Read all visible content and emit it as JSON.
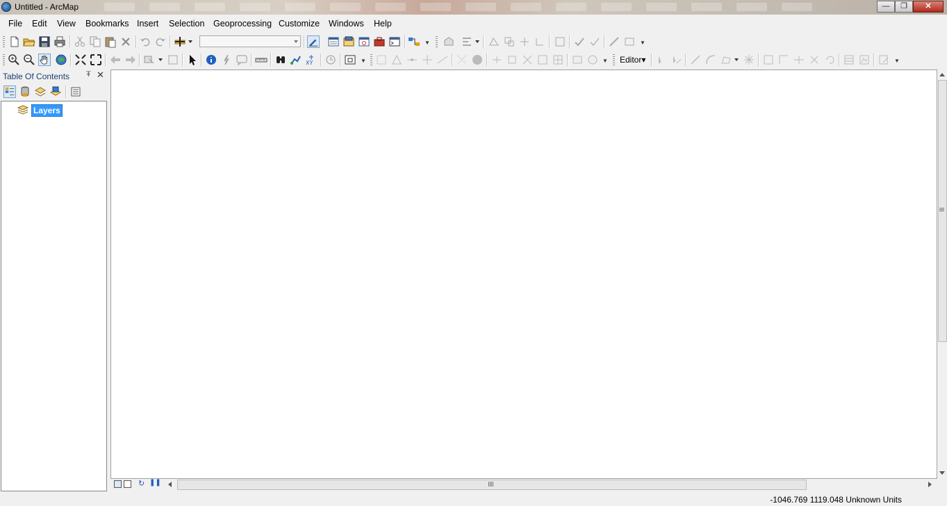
{
  "window": {
    "title": "Untitled - ArcMap"
  },
  "menu": [
    "File",
    "Edit",
    "View",
    "Bookmarks",
    "Insert",
    "Selection",
    "Geoprocessing",
    "Customize",
    "Windows",
    "Help"
  ],
  "toolbar1_icons": [
    "new-document-icon",
    "open-folder-icon",
    "save-icon",
    "print-icon",
    "cut-icon",
    "copy-icon",
    "paste-icon",
    "delete-icon",
    "undo-icon",
    "redo-icon",
    "add-data-icon",
    "editor-toolbar-icon",
    "table-of-contents-icon",
    "catalog-icon",
    "search-window-icon",
    "arctoolbox-icon",
    "python-window-icon",
    "model-builder-icon"
  ],
  "toolbar2_icons": [
    "zoom-in-icon",
    "zoom-out-icon",
    "pan-icon",
    "full-extent-icon",
    "fixed-zoom-in-icon",
    "fixed-zoom-out-icon",
    "back-extent-icon",
    "forward-extent-icon",
    "select-features-icon",
    "clear-selection-icon",
    "select-elements-icon",
    "identify-icon",
    "hyperlink-icon",
    "html-popup-icon",
    "measure-icon",
    "find-icon",
    "find-route-icon",
    "go-to-xy-icon",
    "time-slider-icon",
    "create-viewer-window-icon"
  ],
  "editor": {
    "label": "Editor▾"
  },
  "toc": {
    "title": "Table Of Contents",
    "layer_label": "Layers"
  },
  "status": {
    "coordinates": "-1046.769  1119.048 Unknown Units"
  },
  "colors": {
    "selection": "#3399ff",
    "toc_title": "#1b3f6b"
  }
}
